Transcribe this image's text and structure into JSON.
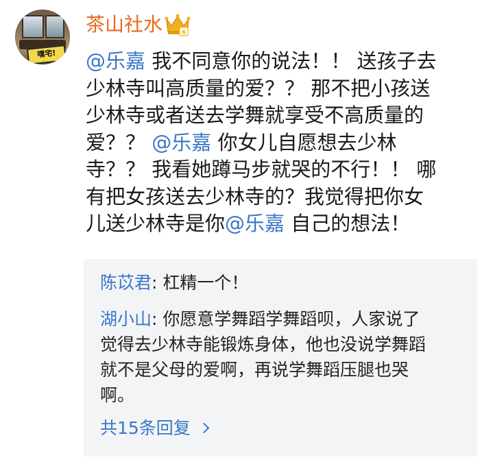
{
  "post": {
    "author": "茶山社水",
    "avatar_sticker": "嘿宅!",
    "badge_icon": "vip-crown-icon",
    "accent_color": "#e8691c",
    "link_color": "#3a76c8",
    "content_lines": [
      [
        {
          "t": "@乐嘉",
          "m": true
        },
        {
          "t": " 我不同意你的说法！！ 送孩子去"
        }
      ],
      [
        {
          "t": "少林寺叫高质量的爱？？ 那不把小孩送"
        }
      ],
      [
        {
          "t": "少林寺或者送去学舞就享受不高质量的"
        }
      ],
      [
        {
          "t": "爱？？ "
        },
        {
          "t": "@乐嘉",
          "m": true
        },
        {
          "t": " 你女儿自愿想去少林"
        }
      ],
      [
        {
          "t": "寺？？ 我看她蹲马步就哭的不行！！ 哪"
        }
      ],
      [
        {
          "t": "有把女孩送去少林寺的？我觉得把你女"
        }
      ],
      [
        {
          "t": "儿送少林寺是你"
        },
        {
          "t": "@乐嘉",
          "m": true
        },
        {
          "t": " 自己的想法！"
        }
      ]
    ]
  },
  "replies": {
    "items": [
      {
        "name": "陈苡君",
        "lines": [
          ": 杠精一个！"
        ]
      },
      {
        "name": "湖小山",
        "lines": [
          ": 你愿意学舞蹈学舞蹈呗，人家说了",
          "觉得去少林寺能锻炼身体，他也没说学舞蹈",
          "就不是父母的爱啊，再说学舞蹈压腿也哭",
          "啊。"
        ]
      }
    ],
    "more_label": "共15条回复"
  }
}
